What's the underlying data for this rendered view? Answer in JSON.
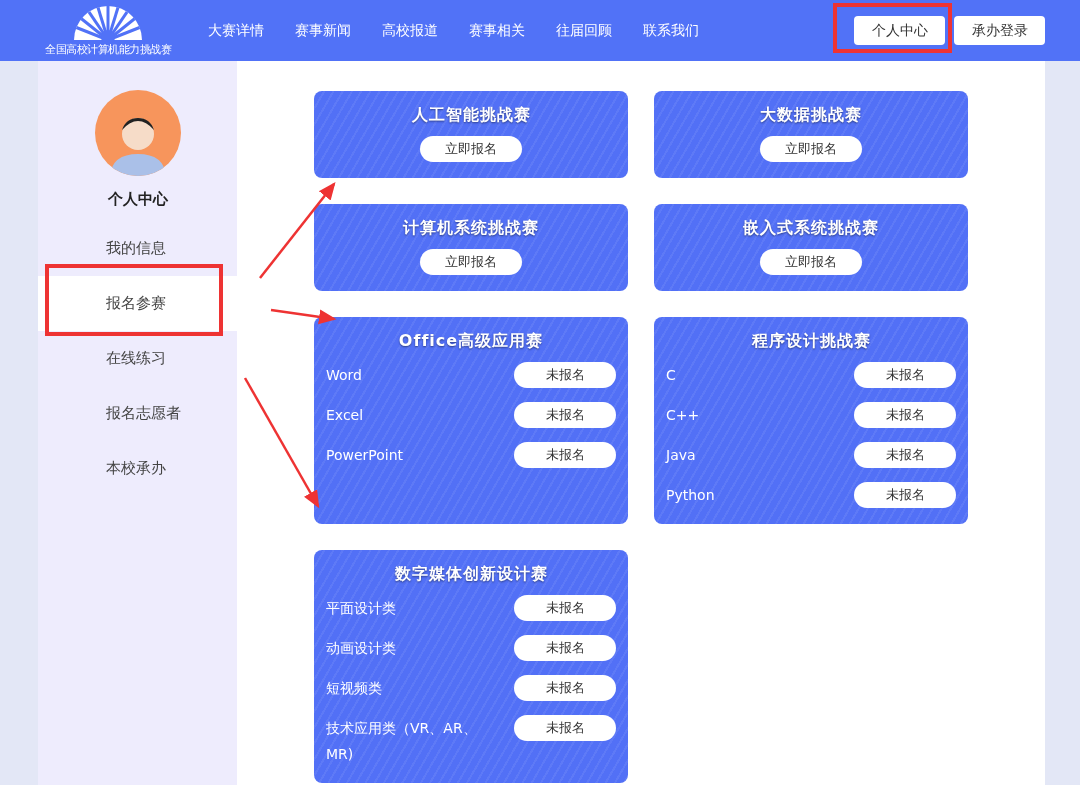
{
  "header": {
    "logo_text": "全国高校计算机能力挑战赛",
    "nav": [
      "大赛详情",
      "赛事新闻",
      "高校报道",
      "赛事相关",
      "往届回顾",
      "联系我们"
    ],
    "buttons": [
      "个人中心",
      "承办登录"
    ]
  },
  "sidebar": {
    "title": "个人中心",
    "items": [
      {
        "label": "我的信息",
        "selected": false
      },
      {
        "label": "报名参赛",
        "selected": true
      },
      {
        "label": "在线练习",
        "selected": false
      },
      {
        "label": "报名志愿者",
        "selected": false
      },
      {
        "label": "本校承办",
        "selected": false
      }
    ]
  },
  "competitions": [
    {
      "kind": "single",
      "title": "人工智能挑战赛",
      "button": "立即报名"
    },
    {
      "kind": "single",
      "title": "大数据挑战赛",
      "button": "立即报名"
    },
    {
      "kind": "single",
      "title": "计算机系统挑战赛",
      "button": "立即报名"
    },
    {
      "kind": "single",
      "title": "嵌入式系统挑战赛",
      "button": "立即报名"
    },
    {
      "kind": "list",
      "title": "Office高级应用赛",
      "entries": [
        {
          "label": "Word",
          "status": "未报名"
        },
        {
          "label": "Excel",
          "status": "未报名"
        },
        {
          "label": "PowerPoint",
          "status": "未报名"
        }
      ]
    },
    {
      "kind": "list",
      "title": "程序设计挑战赛",
      "entries": [
        {
          "label": "C",
          "status": "未报名"
        },
        {
          "label": "C++",
          "status": "未报名"
        },
        {
          "label": "Java",
          "status": "未报名"
        },
        {
          "label": "Python",
          "status": "未报名"
        }
      ]
    },
    {
      "kind": "list",
      "title": "数字媒体创新设计赛",
      "entries": [
        {
          "label": "平面设计类",
          "status": "未报名"
        },
        {
          "label": "动画设计类",
          "status": "未报名"
        },
        {
          "label": "短视频类",
          "status": "未报名"
        },
        {
          "label": "技术应用类（VR、AR、MR)",
          "status": "未报名"
        }
      ]
    }
  ]
}
